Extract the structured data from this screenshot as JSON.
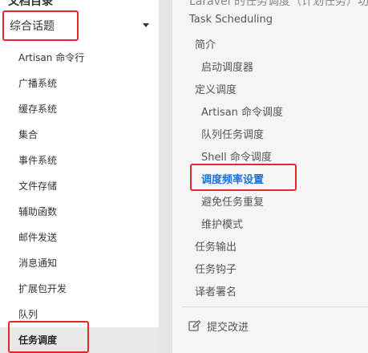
{
  "sidebar": {
    "cut_title": "文档目录",
    "section_header": "综合话题",
    "items": [
      {
        "label": "Artisan 命令行"
      },
      {
        "label": "广播系统"
      },
      {
        "label": "缓存系统"
      },
      {
        "label": "集合"
      },
      {
        "label": "事件系统"
      },
      {
        "label": "文件存储"
      },
      {
        "label": "辅助函数"
      },
      {
        "label": "邮件发送"
      },
      {
        "label": "消息通知"
      },
      {
        "label": "扩展包开发"
      },
      {
        "label": "队列"
      },
      {
        "label": "任务调度"
      }
    ],
    "active_index": 11
  },
  "toc": {
    "cut_title": "Laravel 的任务调度（计划任务）功能",
    "page_title": "Task Scheduling",
    "items": [
      {
        "label": "简介",
        "level": 1
      },
      {
        "label": "启动调度器",
        "level": 2
      },
      {
        "label": "定义调度",
        "level": 1
      },
      {
        "label": "Artisan 命令调度",
        "level": 2
      },
      {
        "label": "队列任务调度",
        "level": 2
      },
      {
        "label": "Shell 命令调度",
        "level": 2
      },
      {
        "label": "调度频率设置",
        "level": 2
      },
      {
        "label": "避免任务重复",
        "level": 2
      },
      {
        "label": "维护模式",
        "level": 2
      },
      {
        "label": "任务输出",
        "level": 1
      },
      {
        "label": "任务钩子",
        "level": 1
      },
      {
        "label": "译者署名",
        "level": 1
      }
    ],
    "active_index": 6,
    "suggest_label": "提交改进",
    "suggest_icon": "edit-icon"
  },
  "colors": {
    "annotation": "#e5262e",
    "active_link": "#1a73d9",
    "sidebar_active_bg": "#e8e8e8",
    "content_bg": "#f5f5f5",
    "gutter_bg": "#e5e5e5"
  }
}
